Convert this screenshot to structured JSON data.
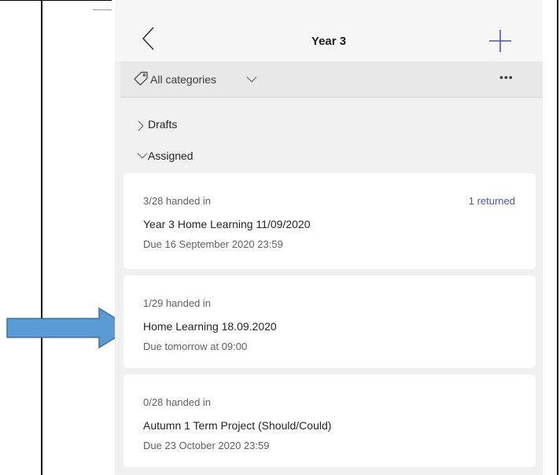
{
  "header": {
    "title": "Year 3",
    "back_icon": "chevron-left-icon",
    "add_icon": "plus-icon"
  },
  "filter": {
    "label": "All categories",
    "tag_icon": "tag-icon",
    "more_icon": "more-icon",
    "more_glyph": "•••"
  },
  "sections": {
    "drafts": "Drafts",
    "assigned": "Assigned"
  },
  "assignments": [
    {
      "handed_in": "3/28 handed in",
      "name": "Year 3 Home Learning 11/09/2020",
      "due": "Due 16 September 2020 23:59",
      "returned": "1 returned"
    },
    {
      "handed_in": "1/29 handed in",
      "name": "Home Learning 18.09.2020",
      "due": "Due tomorrow at 09:00"
    },
    {
      "handed_in": "0/28 handed in",
      "name": "Autumn 1 Term Project (Should/Could)",
      "due": "Due 23 October 2020 23:59"
    }
  ],
  "colors": {
    "accent": "#4b53bc",
    "arrow_fill": "#5b9bd5",
    "arrow_stroke": "#41719c"
  }
}
